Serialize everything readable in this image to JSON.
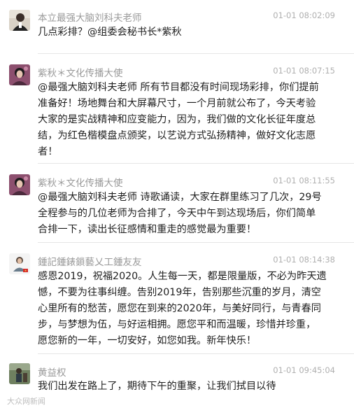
{
  "messages": [
    {
      "name": "本立最强大脑刘科夫老师",
      "time": "01-01 08:02:09",
      "lines": [
        "几点彩排？@组委会秘书长*紫秋"
      ]
    },
    {
      "name": "紫秋＊文化传播大使",
      "time": "01-01 08:07:15",
      "lines": [
        "@最强大脑刘科夫老师 所有节目都没有时间现场彩排，你们提前",
        "准备好！场地舞台和大屏幕尺寸，一个月前就公布了，今天考验",
        "大家的是实战精神和应变能力，因为，我们做的文化长征年度总",
        "结，为红色楷模盘点颁奖，以艺说方式弘扬精神，做好文化志愿",
        "者！"
      ]
    },
    {
      "name": "紫秋＊文化传播大使",
      "time": "01-01 08:11:55",
      "lines": [
        "@最强大脑刘科夫老师 诗歌诵读，大家在群里练习了几次，29号",
        "全程参与的几位老师为合排了，今天中午到达现场后，你们简单",
        "合排一下，读出长征感情和重走的感觉最为重要！"
      ]
    },
    {
      "name": "鍾記鍾錶鎖藝乂工鍾友友",
      "time": "01-01 08:14:38",
      "lines": [
        "感恩2019，祝福2020。人生每一天，都是限量版，不必为昨天遗",
        "憾，不要为往事纠缠。告别2019年，告别那些沉重的岁月，清空",
        "心里所有的愁苦，愿您在到来的2020年，与美好同行，与青春同",
        "步，与梦想为伍，与好运相拥。愿您平和而温暖，珍惜并珍重，",
        "愿您新的一年，一切安好，如您如我。新年快乐！"
      ]
    },
    {
      "name": "黄益权",
      "time": "01-01 09:45:04",
      "lines": [
        "我们出发在路上了，期待下午的重聚，让我们拭目以待"
      ]
    }
  ],
  "watermark": "大众网新闻"
}
